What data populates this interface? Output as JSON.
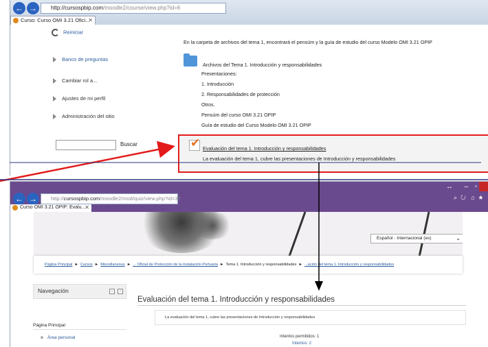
{
  "top": {
    "url_host": "http://cursospbip.com",
    "url_path": "/moodle2/course/view.php?id=6",
    "tab_label": "Curso: Curso OMI 3.21 Ofici...",
    "sidebar": {
      "reiniciar": "Reiniciar",
      "banco": "Banco de preguntas",
      "cambiar_rol": "Cambiar rol a...",
      "ajustes": "Ajustes de mi perfil",
      "admin": "Administración del sitio",
      "search_button": "Buscar"
    },
    "content": {
      "intro": "En la carpeta de archivos del tema 1, encontrará el pensúm y la guía de estudio del curso Modelo OMI 3.21 OPIP",
      "folder_link": "Archivos del Tema 1. Introducción y responsabilidades",
      "lines": [
        "Presentaciones:",
        "1. Introducción",
        "2. Responsabilidades de protección",
        "Otros.",
        "Pensúm del curso OMI 3.21 OPIP",
        "Guía de estudio del Curso Modelo OMI 3.21 OPIP"
      ],
      "quiz_link": "Evaluación del tema 1. Introducción y responsabilidades",
      "quiz_desc": "La evaluación del tema 1, cubre las presentaciones de Introducción y responsabilidades"
    }
  },
  "bottom": {
    "url_host": "cursospbip.com",
    "url_prefix": "http://",
    "url_path": "/moodle2/mod/quiz/view.php?id=37",
    "tab_label": "Curso OMI 3.21 OPIP: Evalu...",
    "language": "Español - Internacional (es)",
    "breadcrumb": [
      "Página Principal",
      "Cursos",
      "Miscellaneous",
      "... Oficial de Protección de la Instalación Portuaria",
      "Tema 1. Introducción y responsabilidades",
      "...ación del tema 1. Introducción y responsabilidades"
    ],
    "nav_title": "Navegación",
    "nav_items": [
      "Página Principal",
      "Área personal"
    ],
    "quiz_title": "Evaluación del tema 1. Introducción y responsabilidades",
    "quiz_desc": "La evaluación del tema 1, cubre las presentaciones de Introducción y responsabilidades",
    "attempts_allowed": "Intentos permitidos: 1",
    "attempts": "Intentos: 2"
  },
  "colors": {
    "highlight_border": "#e31b1b",
    "link": "#2d5d9f",
    "chrome_bottom": "#6a4a8e"
  }
}
